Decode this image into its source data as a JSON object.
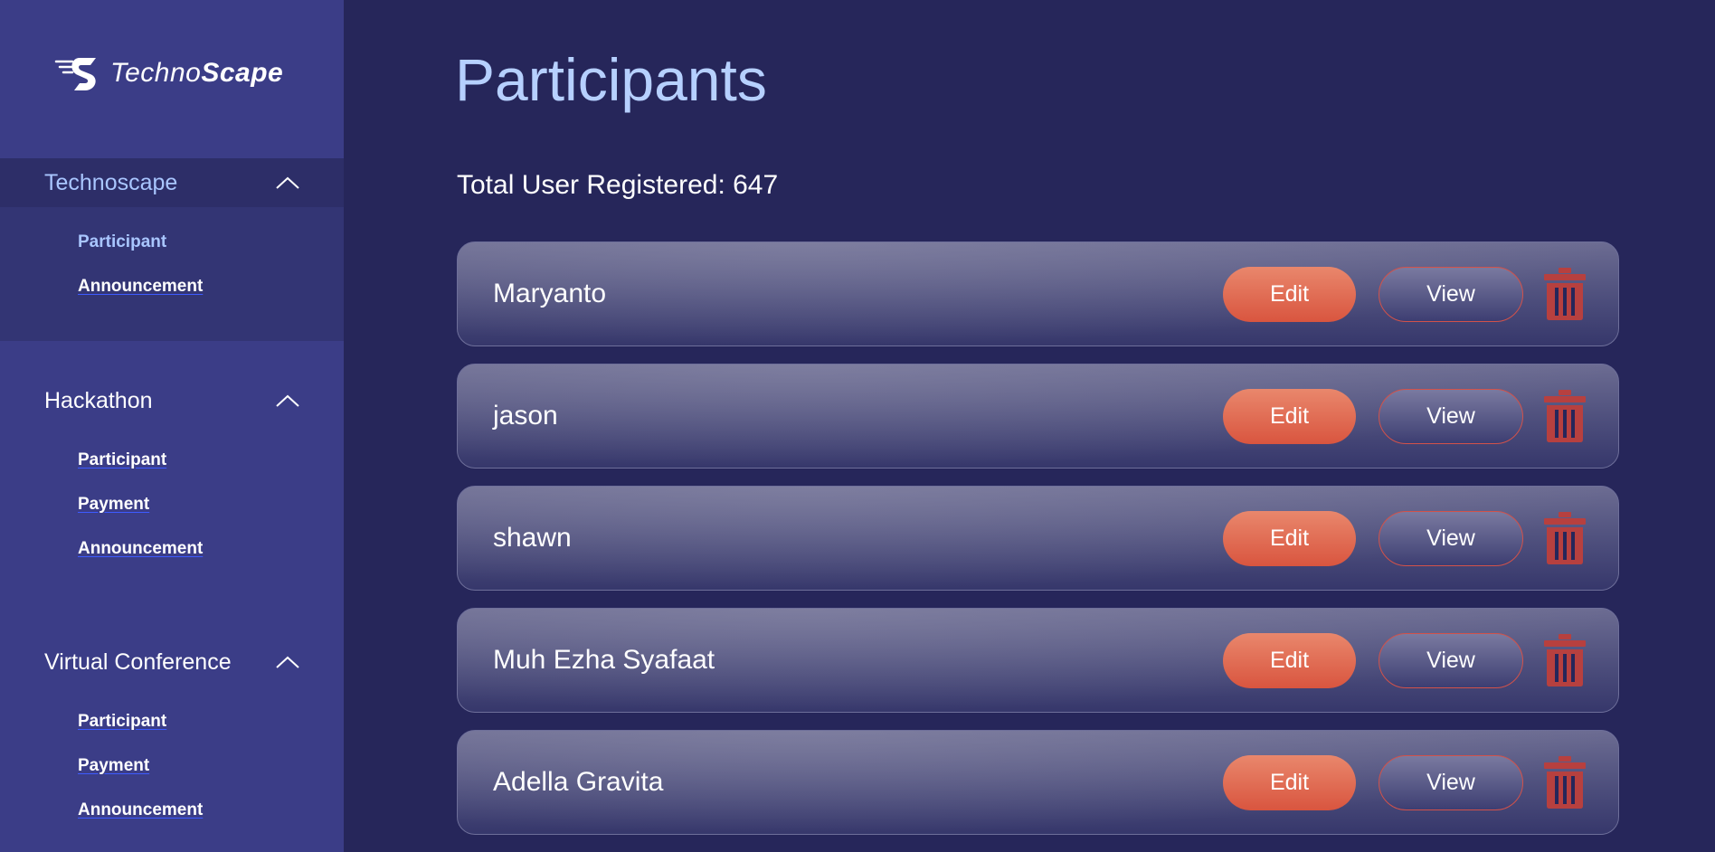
{
  "brand": {
    "logo_text_light": "Techno",
    "logo_text_bold": "Scape"
  },
  "sidebar": {
    "groups": [
      {
        "title": "Technoscape",
        "items": [
          "Participant",
          "Announcement"
        ]
      },
      {
        "title": "Hackathon",
        "items": [
          "Participant",
          "Payment",
          "Announcement"
        ]
      },
      {
        "title": "Virtual Conference",
        "items": [
          "Participant",
          "Payment",
          "Announcement"
        ]
      }
    ]
  },
  "main": {
    "title": "Participants",
    "total_label": "Total User Registered: 647",
    "edit_label": "Edit",
    "view_label": "View",
    "participants": [
      "Maryanto",
      "jason",
      "shawn",
      "Muh Ezha Syafaat",
      "Adella Gravita"
    ]
  },
  "colors": {
    "sidebar_bg": "#3b3d87",
    "main_bg": "#26265a",
    "accent_title": "#b6d0ff",
    "edit_button": "#e2674f",
    "trash_icon": "#b7403f"
  },
  "icons": {
    "group_toggle": "chevron-up-icon",
    "delete": "trash-icon"
  }
}
